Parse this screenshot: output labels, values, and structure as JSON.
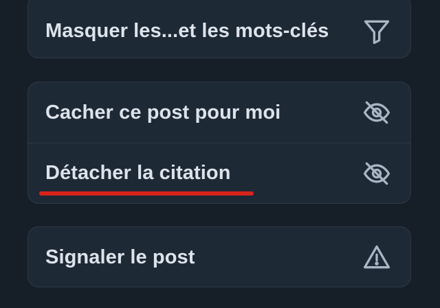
{
  "menu": {
    "group1": {
      "mute_words": {
        "label": "Masquer les...et les mots-clés",
        "icon": "filter-icon"
      }
    },
    "group2": {
      "hide_post": {
        "label": "Cacher ce post pour moi",
        "icon": "eye-slash-icon"
      },
      "detach_quote": {
        "label": "Détacher la citation",
        "icon": "eye-slash-icon"
      }
    },
    "group3": {
      "report_post": {
        "label": "Signaler le post",
        "icon": "warning-triangle-icon"
      }
    }
  },
  "colors": {
    "background": "#161e27",
    "card": "#1e2936",
    "border": "#2c3947",
    "text": "#dce3ea",
    "icon": "#aab6c3",
    "annotation_underline": "#d8231b"
  }
}
